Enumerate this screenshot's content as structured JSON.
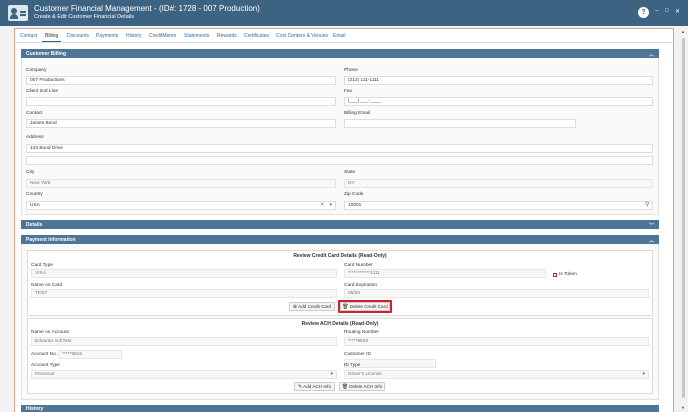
{
  "window": {
    "title": "Customer Financial Management - (ID#: 1728 - 007 Production)",
    "subtitle": "Create & Edit Customer Financial Details",
    "help_label": "?",
    "minimize": "–",
    "maximize": "□",
    "close": "✕"
  },
  "tabs": [
    "Contact",
    "Billing",
    "Discounts",
    "Payments",
    "History",
    "CreditMemo",
    "Statements",
    "Rewards",
    "Certificates",
    "Cost Centers & Venues",
    "Email"
  ],
  "billing": {
    "header": "Customer Billing",
    "company_label": "Company",
    "company": "007 Productions",
    "phone_label": "Phone",
    "phone": "(212) 111-1111",
    "client2_label": "Client 2nd Line",
    "client2": "",
    "fax_label": "Fax",
    "fax_placeholder": "(___) ___-____",
    "contact_label": "Contact",
    "contact": "James Bond",
    "billing_email_label": "Billing Email",
    "billing_email": "",
    "address_label": "Address",
    "address1": "123 Bond Drive",
    "address2": "",
    "city_label": "City",
    "city": "New York",
    "state_label": "State",
    "state": "NY",
    "country_label": "Country",
    "country": "USA",
    "zip_label": "Zip Code",
    "zip": "10001"
  },
  "details": {
    "header": "Details"
  },
  "payment": {
    "header": "Payment Information",
    "cc_title": "Review Credit Card Details (Read-Only)",
    "card_type_label": "Card Type",
    "card_type": "VISA",
    "card_number_label": "Card Number",
    "card_number": "************1111",
    "is_token_label": "Is Token",
    "name_on_card_label": "Name on Card",
    "name_on_card": "TEST",
    "card_exp_label": "Card Expiration",
    "card_exp": "05/26",
    "add_cc_label": "Add Credit Card",
    "delete_cc_label": "Delete Credit Card",
    "ach_title": "Review ACH Details (Read-Only)",
    "name_on_account_label": "Name on Account",
    "name_on_account": "Eduardo AchTest",
    "routing_label": "Routing Number",
    "routing": "*****9629",
    "account_no_label": "Account No.",
    "account_no": "*****9615",
    "customer_id_label": "Customer ID",
    "customer_id": "",
    "account_type_label": "Account Type",
    "account_type": "Personal",
    "id_type_label": "ID Type",
    "id_type": "Driver's License",
    "add_ach_label": "Add ACH Info",
    "delete_ach_label": "Delete ACH Info"
  },
  "next_section": {
    "header": "History"
  },
  "colors": {
    "header_bg": "#3d6383",
    "section_bg": "#4d7597",
    "highlight": "#d0202a",
    "link": "#2e6da4"
  }
}
